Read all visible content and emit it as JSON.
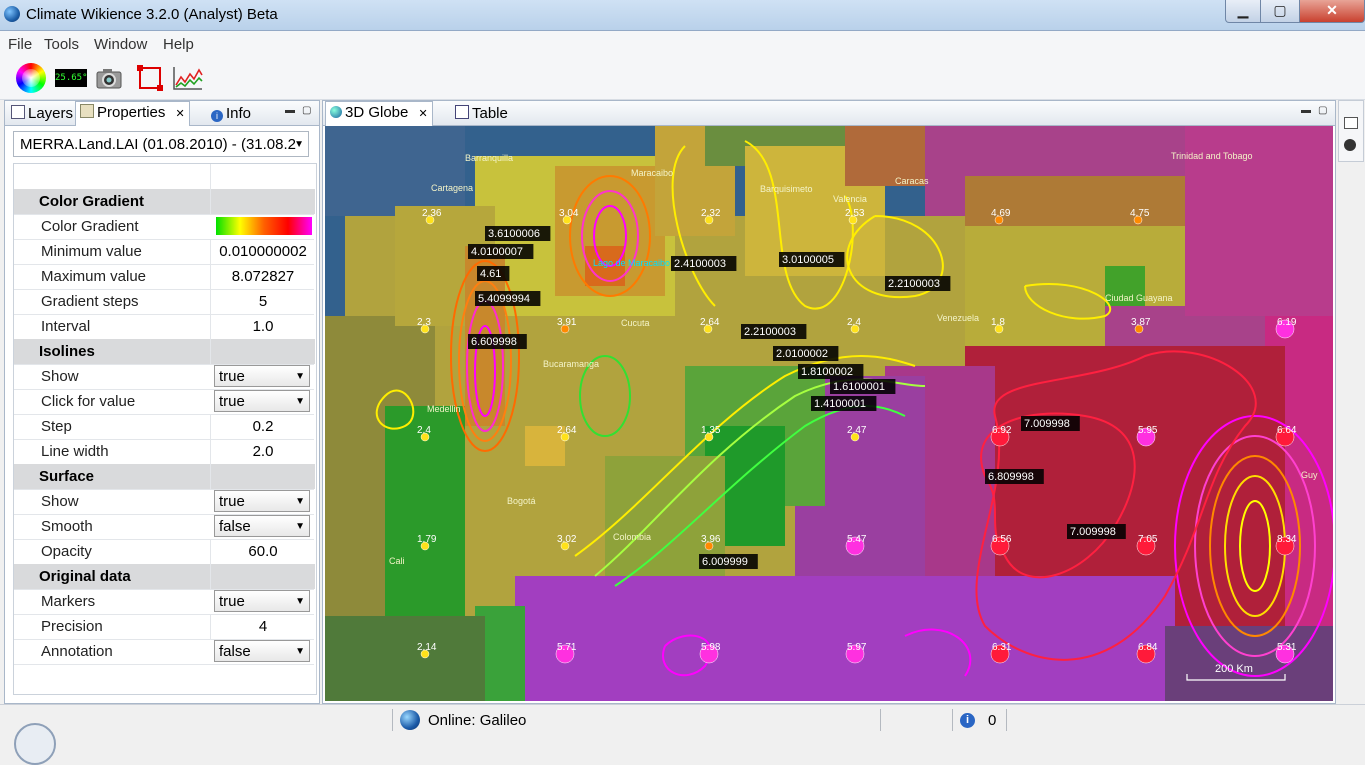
{
  "window": {
    "title": "Climate Wikience 3.2.0 (Analyst) Beta"
  },
  "menu": [
    "File",
    "Tools",
    "Window",
    "Help"
  ],
  "toolbar": {
    "temp_readout": "25.65°"
  },
  "left_panel": {
    "tabs": [
      "Layers",
      "Properties",
      "Info"
    ],
    "dataset": "MERRA.Land.LAI  (01.08.2010)  -  (31.08.2",
    "properties": [
      {
        "label": "Color Gradient",
        "section": true
      },
      {
        "label": "Color Gradient",
        "value": "",
        "gradient": true
      },
      {
        "label": "Minimum value",
        "value": "0.010000002"
      },
      {
        "label": "Maximum value",
        "value": "8.072827"
      },
      {
        "label": "Gradient steps",
        "value": "5"
      },
      {
        "label": "Interval",
        "value": "1.0"
      },
      {
        "label": "Isolines",
        "section": true
      },
      {
        "label": "Show",
        "value": "true",
        "dropdown": true
      },
      {
        "label": "Click for value",
        "value": "true",
        "dropdown": true
      },
      {
        "label": "Step",
        "value": "0.2"
      },
      {
        "label": "Line width",
        "value": "2.0"
      },
      {
        "label": "Surface",
        "section": true
      },
      {
        "label": "Show",
        "value": "true",
        "dropdown": true
      },
      {
        "label": "Smooth",
        "value": "false",
        "dropdown": true
      },
      {
        "label": "Opacity",
        "value": "60.0"
      },
      {
        "label": "Original data",
        "section": true
      },
      {
        "label": "Markers",
        "value": "true",
        "dropdown": true
      },
      {
        "label": "Precision",
        "value": "4"
      },
      {
        "label": "Annotation",
        "value": "false",
        "dropdown": true
      }
    ]
  },
  "globe_panel": {
    "tabs": [
      "3D Globe",
      "Table"
    ],
    "place_labels": [
      "Barranquilla",
      "Cartagena",
      "Maracaibo",
      "Barquisimeto",
      "Valencia",
      "Caracas",
      "Trinidad and Tobago",
      "Lago de Maracaibo",
      "Cucuta",
      "Venezuela",
      "Ciudad Guayana",
      "Bucaramanga",
      "Medellin",
      "Bogotá",
      "Colombia",
      "Cali",
      "Guy"
    ],
    "isoline_labels": [
      "3.6100006",
      "4.0100007",
      "4.61",
      "5.4099994",
      "6.609998",
      "2.4100003",
      "3.0100005",
      "2.2100003",
      "2.2100003",
      "2.0100002",
      "1.8100002",
      "1.6100001",
      "1.4100001",
      "7.009998",
      "6.809998",
      "7.009998",
      "6.009999"
    ],
    "marker_values": [
      "2.36",
      "3.04",
      "2.32",
      "2.53",
      "4.69",
      "4.75",
      "2.3",
      "3.91",
      "2.64",
      "2.4",
      "1.8",
      "3.87",
      "6.19",
      "2.4",
      "2.64",
      "1.35",
      "2.47",
      "6.92",
      "5.95",
      "6.64",
      "1.79",
      "3.02",
      "3.96",
      "5.47",
      "6.56",
      "7.05",
      "8.34",
      "2.14",
      "5.71",
      "5.98",
      "5.97",
      "6.31",
      "6.84",
      "5.31"
    ],
    "scale_label": "200 Km"
  },
  "status": {
    "server": "Online: Galileo",
    "count": "0"
  }
}
